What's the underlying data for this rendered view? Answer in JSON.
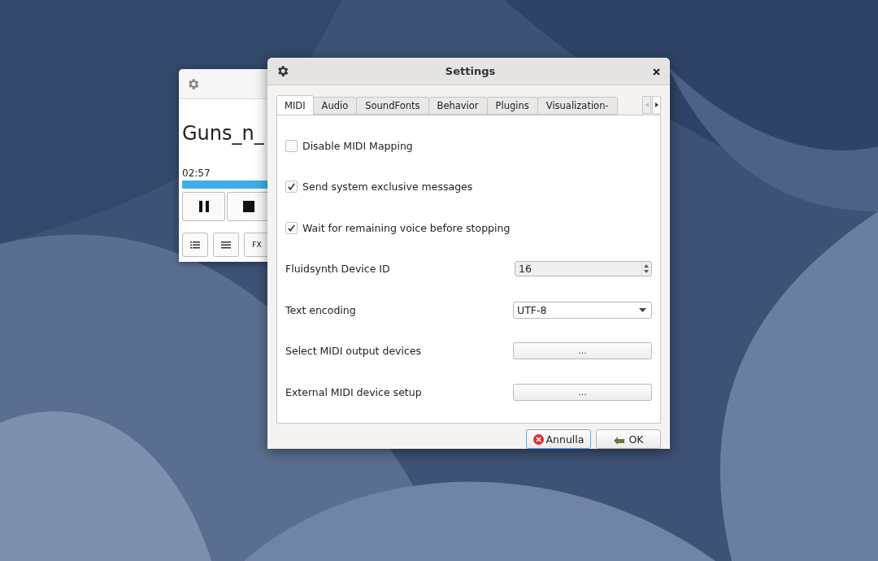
{
  "player": {
    "title": "Guns_n_",
    "time": "02:57",
    "progress": {
      "level": 1
    },
    "transport": [
      {
        "kind": "pause"
      },
      {
        "kind": "stop"
      }
    ],
    "tools": [
      {
        "kind": "list"
      },
      {
        "kind": "menu"
      },
      {
        "kind": "text",
        "label": "FX"
      }
    ]
  },
  "settings": {
    "title": "Settings",
    "tabs": [
      {
        "label": "MIDI",
        "selected": true
      },
      {
        "label": "Audio",
        "selected": false
      },
      {
        "label": "SoundFonts",
        "selected": false
      },
      {
        "label": "Behavior",
        "selected": false
      },
      {
        "label": "Plugins",
        "selected": false
      },
      {
        "label": "Visualization-",
        "selected": false
      }
    ],
    "rows": [
      {
        "kind": "checkbox",
        "label": "Disable MIDI Mapping",
        "checked": false
      },
      {
        "kind": "checkbox",
        "label": "Send system exclusive messages",
        "checked": true
      },
      {
        "kind": "checkbox",
        "label": "Wait for remaining voice before stopping",
        "checked": true
      },
      {
        "kind": "spin",
        "label": "Fluidsynth Device ID",
        "value": "16"
      },
      {
        "kind": "combo",
        "label": "Text encoding",
        "value": "UTF-8"
      },
      {
        "kind": "button",
        "label": "Select MIDI output devices",
        "value": "..."
      },
      {
        "kind": "button",
        "label": "External MIDI device setup",
        "value": "..."
      }
    ],
    "buttons": [
      {
        "kind": "cancel",
        "label": "Annulla"
      },
      {
        "kind": "ok",
        "label": "OK"
      }
    ]
  }
}
